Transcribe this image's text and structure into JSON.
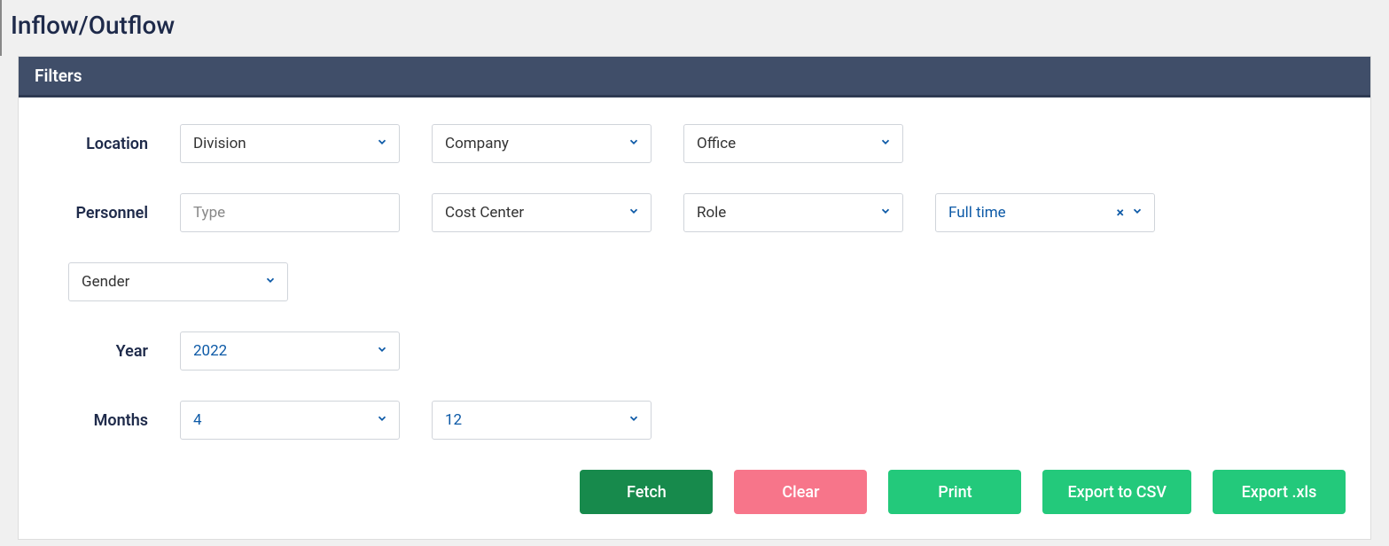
{
  "page": {
    "title": "Inflow/Outflow"
  },
  "panel": {
    "header": "Filters"
  },
  "filters": {
    "location": {
      "label": "Location",
      "division": {
        "placeholder": "Division"
      },
      "company": {
        "placeholder": "Company"
      },
      "office": {
        "placeholder": "Office"
      }
    },
    "personnel": {
      "label": "Personnel",
      "type": {
        "placeholder": "Type"
      },
      "cost_center": {
        "placeholder": "Cost Center"
      },
      "role": {
        "placeholder": "Role"
      },
      "employment": {
        "value": "Full time"
      }
    },
    "gender": {
      "placeholder": "Gender"
    },
    "year": {
      "label": "Year",
      "value": "2022"
    },
    "months": {
      "label": "Months",
      "from": {
        "value": "4"
      },
      "to": {
        "value": "12"
      }
    }
  },
  "buttons": {
    "fetch": "Fetch",
    "clear": "Clear",
    "print": "Print",
    "export_csv": "Export to CSV",
    "export_xls": "Export .xls"
  }
}
